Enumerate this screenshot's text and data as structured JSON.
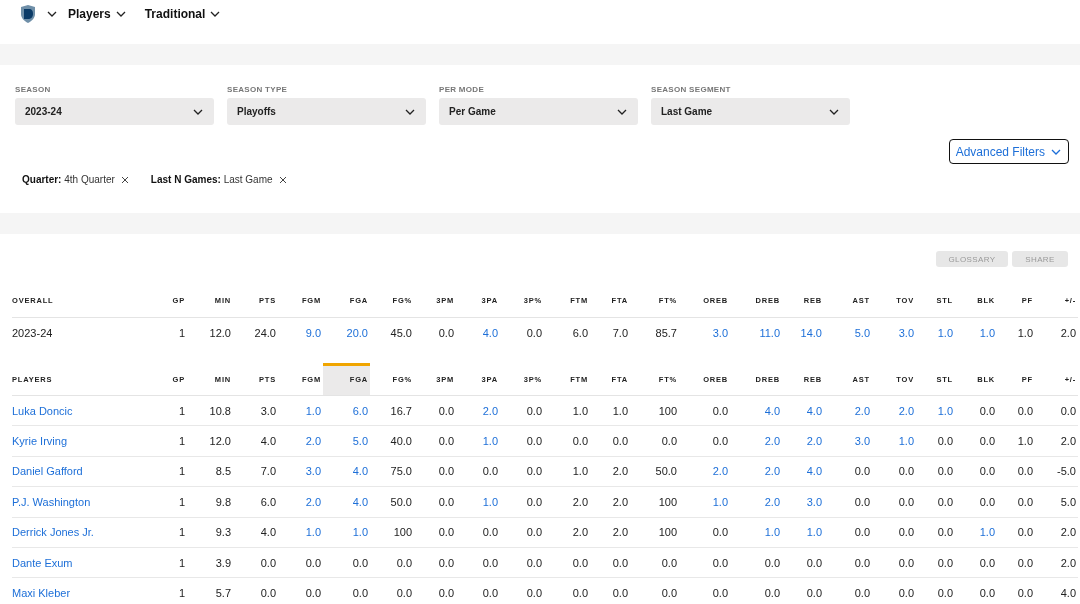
{
  "nav": {
    "items": [
      {
        "label": "Players"
      },
      {
        "label": "Traditional"
      }
    ]
  },
  "filters": [
    {
      "label": "SEASON",
      "value": "2023-24"
    },
    {
      "label": "SEASON TYPE",
      "value": "Playoffs"
    },
    {
      "label": "PER MODE",
      "value": "Per Game"
    },
    {
      "label": "SEASON SEGMENT",
      "value": "Last Game"
    }
  ],
  "advanced_filters": "Advanced Filters",
  "chips": [
    {
      "label": "Quarter:",
      "value": "4th Quarter"
    },
    {
      "label": "Last N Games:",
      "value": "Last Game"
    }
  ],
  "actions": [
    "GLOSSARY",
    "SHARE"
  ],
  "overall": {
    "columns": [
      {
        "label": "OVERALL",
        "sorted": false
      },
      {
        "label": "GP",
        "sorted": false
      },
      {
        "label": "MIN",
        "sorted": false
      },
      {
        "label": "PTS",
        "sorted": false
      },
      {
        "label": "FGM",
        "sorted": false
      },
      {
        "label": "FGA",
        "sorted": false
      },
      {
        "label": "FG%",
        "sorted": false
      },
      {
        "label": "3PM",
        "sorted": false
      },
      {
        "label": "3PA",
        "sorted": false
      },
      {
        "label": "3P%",
        "sorted": false
      },
      {
        "label": "FTM",
        "sorted": false
      },
      {
        "label": "FTA",
        "sorted": false
      },
      {
        "label": "FT%",
        "sorted": false
      },
      {
        "label": "OREB",
        "sorted": false
      },
      {
        "label": "DREB",
        "sorted": false
      },
      {
        "label": "REB",
        "sorted": false
      },
      {
        "label": "AST",
        "sorted": false
      },
      {
        "label": "TOV",
        "sorted": false
      },
      {
        "label": "STL",
        "sorted": false
      },
      {
        "label": "BLK",
        "sorted": false
      },
      {
        "label": "PF",
        "sorted": false
      },
      {
        "label": "+/-",
        "sorted": false
      }
    ],
    "rows": [
      {
        "cells": [
          {
            "text": "2023-24",
            "link": false
          },
          {
            "text": "1",
            "link": false
          },
          {
            "text": "12.0",
            "link": false
          },
          {
            "text": "24.0",
            "link": false
          },
          {
            "text": "9.0",
            "link": true
          },
          {
            "text": "20.0",
            "link": true
          },
          {
            "text": "45.0",
            "link": false
          },
          {
            "text": "0.0",
            "link": false
          },
          {
            "text": "4.0",
            "link": true
          },
          {
            "text": "0.0",
            "link": false
          },
          {
            "text": "6.0",
            "link": false
          },
          {
            "text": "7.0",
            "link": false
          },
          {
            "text": "85.7",
            "link": false
          },
          {
            "text": "3.0",
            "link": true
          },
          {
            "text": "11.0",
            "link": true
          },
          {
            "text": "14.0",
            "link": true
          },
          {
            "text": "5.0",
            "link": true
          },
          {
            "text": "3.0",
            "link": true
          },
          {
            "text": "1.0",
            "link": true
          },
          {
            "text": "1.0",
            "link": true
          },
          {
            "text": "1.0",
            "link": false
          },
          {
            "text": "2.0",
            "link": false
          }
        ]
      }
    ]
  },
  "players": {
    "columns": [
      {
        "label": "PLAYERS",
        "sorted": false
      },
      {
        "label": "GP",
        "sorted": false
      },
      {
        "label": "MIN",
        "sorted": false
      },
      {
        "label": "PTS",
        "sorted": false
      },
      {
        "label": "FGM",
        "sorted": false
      },
      {
        "label": "FGA",
        "sorted": true
      },
      {
        "label": "FG%",
        "sorted": false
      },
      {
        "label": "3PM",
        "sorted": false
      },
      {
        "label": "3PA",
        "sorted": false
      },
      {
        "label": "3P%",
        "sorted": false
      },
      {
        "label": "FTM",
        "sorted": false
      },
      {
        "label": "FTA",
        "sorted": false
      },
      {
        "label": "FT%",
        "sorted": false
      },
      {
        "label": "OREB",
        "sorted": false
      },
      {
        "label": "DREB",
        "sorted": false
      },
      {
        "label": "REB",
        "sorted": false
      },
      {
        "label": "AST",
        "sorted": false
      },
      {
        "label": "TOV",
        "sorted": false
      },
      {
        "label": "STL",
        "sorted": false
      },
      {
        "label": "BLK",
        "sorted": false
      },
      {
        "label": "PF",
        "sorted": false
      },
      {
        "label": "+/-",
        "sorted": false
      }
    ],
    "rows": [
      {
        "cells": [
          {
            "text": "Luka Doncic",
            "link": true
          },
          {
            "text": "1",
            "link": false
          },
          {
            "text": "10.8",
            "link": false
          },
          {
            "text": "3.0",
            "link": false
          },
          {
            "text": "1.0",
            "link": true
          },
          {
            "text": "6.0",
            "link": true
          },
          {
            "text": "16.7",
            "link": false
          },
          {
            "text": "0.0",
            "link": false
          },
          {
            "text": "2.0",
            "link": true
          },
          {
            "text": "0.0",
            "link": false
          },
          {
            "text": "1.0",
            "link": false
          },
          {
            "text": "1.0",
            "link": false
          },
          {
            "text": "100",
            "link": false
          },
          {
            "text": "0.0",
            "link": false
          },
          {
            "text": "4.0",
            "link": true
          },
          {
            "text": "4.0",
            "link": true
          },
          {
            "text": "2.0",
            "link": true
          },
          {
            "text": "2.0",
            "link": true
          },
          {
            "text": "1.0",
            "link": true
          },
          {
            "text": "0.0",
            "link": false
          },
          {
            "text": "0.0",
            "link": false
          },
          {
            "text": "0.0",
            "link": false
          }
        ]
      },
      {
        "cells": [
          {
            "text": "Kyrie Irving",
            "link": true
          },
          {
            "text": "1",
            "link": false
          },
          {
            "text": "12.0",
            "link": false
          },
          {
            "text": "4.0",
            "link": false
          },
          {
            "text": "2.0",
            "link": true
          },
          {
            "text": "5.0",
            "link": true
          },
          {
            "text": "40.0",
            "link": false
          },
          {
            "text": "0.0",
            "link": false
          },
          {
            "text": "1.0",
            "link": true
          },
          {
            "text": "0.0",
            "link": false
          },
          {
            "text": "0.0",
            "link": false
          },
          {
            "text": "0.0",
            "link": false
          },
          {
            "text": "0.0",
            "link": false
          },
          {
            "text": "0.0",
            "link": false
          },
          {
            "text": "2.0",
            "link": true
          },
          {
            "text": "2.0",
            "link": true
          },
          {
            "text": "3.0",
            "link": true
          },
          {
            "text": "1.0",
            "link": true
          },
          {
            "text": "0.0",
            "link": false
          },
          {
            "text": "0.0",
            "link": false
          },
          {
            "text": "1.0",
            "link": false
          },
          {
            "text": "2.0",
            "link": false
          }
        ]
      },
      {
        "cells": [
          {
            "text": "Daniel Gafford",
            "link": true
          },
          {
            "text": "1",
            "link": false
          },
          {
            "text": "8.5",
            "link": false
          },
          {
            "text": "7.0",
            "link": false
          },
          {
            "text": "3.0",
            "link": true
          },
          {
            "text": "4.0",
            "link": true
          },
          {
            "text": "75.0",
            "link": false
          },
          {
            "text": "0.0",
            "link": false
          },
          {
            "text": "0.0",
            "link": false
          },
          {
            "text": "0.0",
            "link": false
          },
          {
            "text": "1.0",
            "link": false
          },
          {
            "text": "2.0",
            "link": false
          },
          {
            "text": "50.0",
            "link": false
          },
          {
            "text": "2.0",
            "link": true
          },
          {
            "text": "2.0",
            "link": true
          },
          {
            "text": "4.0",
            "link": true
          },
          {
            "text": "0.0",
            "link": false
          },
          {
            "text": "0.0",
            "link": false
          },
          {
            "text": "0.0",
            "link": false
          },
          {
            "text": "0.0",
            "link": false
          },
          {
            "text": "0.0",
            "link": false
          },
          {
            "text": "-5.0",
            "link": false
          }
        ]
      },
      {
        "cells": [
          {
            "text": "P.J. Washington",
            "link": true
          },
          {
            "text": "1",
            "link": false
          },
          {
            "text": "9.8",
            "link": false
          },
          {
            "text": "6.0",
            "link": false
          },
          {
            "text": "2.0",
            "link": true
          },
          {
            "text": "4.0",
            "link": true
          },
          {
            "text": "50.0",
            "link": false
          },
          {
            "text": "0.0",
            "link": false
          },
          {
            "text": "1.0",
            "link": true
          },
          {
            "text": "0.0",
            "link": false
          },
          {
            "text": "2.0",
            "link": false
          },
          {
            "text": "2.0",
            "link": false
          },
          {
            "text": "100",
            "link": false
          },
          {
            "text": "1.0",
            "link": true
          },
          {
            "text": "2.0",
            "link": true
          },
          {
            "text": "3.0",
            "link": true
          },
          {
            "text": "0.0",
            "link": false
          },
          {
            "text": "0.0",
            "link": false
          },
          {
            "text": "0.0",
            "link": false
          },
          {
            "text": "0.0",
            "link": false
          },
          {
            "text": "0.0",
            "link": false
          },
          {
            "text": "5.0",
            "link": false
          }
        ]
      },
      {
        "cells": [
          {
            "text": "Derrick Jones Jr.",
            "link": true
          },
          {
            "text": "1",
            "link": false
          },
          {
            "text": "9.3",
            "link": false
          },
          {
            "text": "4.0",
            "link": false
          },
          {
            "text": "1.0",
            "link": true
          },
          {
            "text": "1.0",
            "link": true
          },
          {
            "text": "100",
            "link": false
          },
          {
            "text": "0.0",
            "link": false
          },
          {
            "text": "0.0",
            "link": false
          },
          {
            "text": "0.0",
            "link": false
          },
          {
            "text": "2.0",
            "link": false
          },
          {
            "text": "2.0",
            "link": false
          },
          {
            "text": "100",
            "link": false
          },
          {
            "text": "0.0",
            "link": false
          },
          {
            "text": "1.0",
            "link": true
          },
          {
            "text": "1.0",
            "link": true
          },
          {
            "text": "0.0",
            "link": false
          },
          {
            "text": "0.0",
            "link": false
          },
          {
            "text": "0.0",
            "link": false
          },
          {
            "text": "1.0",
            "link": true
          },
          {
            "text": "0.0",
            "link": false
          },
          {
            "text": "2.0",
            "link": false
          }
        ]
      },
      {
        "cells": [
          {
            "text": "Dante Exum",
            "link": true
          },
          {
            "text": "1",
            "link": false
          },
          {
            "text": "3.9",
            "link": false
          },
          {
            "text": "0.0",
            "link": false
          },
          {
            "text": "0.0",
            "link": false
          },
          {
            "text": "0.0",
            "link": false
          },
          {
            "text": "0.0",
            "link": false
          },
          {
            "text": "0.0",
            "link": false
          },
          {
            "text": "0.0",
            "link": false
          },
          {
            "text": "0.0",
            "link": false
          },
          {
            "text": "0.0",
            "link": false
          },
          {
            "text": "0.0",
            "link": false
          },
          {
            "text": "0.0",
            "link": false
          },
          {
            "text": "0.0",
            "link": false
          },
          {
            "text": "0.0",
            "link": false
          },
          {
            "text": "0.0",
            "link": false
          },
          {
            "text": "0.0",
            "link": false
          },
          {
            "text": "0.0",
            "link": false
          },
          {
            "text": "0.0",
            "link": false
          },
          {
            "text": "0.0",
            "link": false
          },
          {
            "text": "0.0",
            "link": false
          },
          {
            "text": "2.0",
            "link": false
          }
        ]
      },
      {
        "cells": [
          {
            "text": "Maxi Kleber",
            "link": true
          },
          {
            "text": "1",
            "link": false
          },
          {
            "text": "5.7",
            "link": false
          },
          {
            "text": "0.0",
            "link": false
          },
          {
            "text": "0.0",
            "link": false
          },
          {
            "text": "0.0",
            "link": false
          },
          {
            "text": "0.0",
            "link": false
          },
          {
            "text": "0.0",
            "link": false
          },
          {
            "text": "0.0",
            "link": false
          },
          {
            "text": "0.0",
            "link": false
          },
          {
            "text": "0.0",
            "link": false
          },
          {
            "text": "0.0",
            "link": false
          },
          {
            "text": "0.0",
            "link": false
          },
          {
            "text": "0.0",
            "link": false
          },
          {
            "text": "0.0",
            "link": false
          },
          {
            "text": "0.0",
            "link": false
          },
          {
            "text": "0.0",
            "link": false
          },
          {
            "text": "0.0",
            "link": false
          },
          {
            "text": "0.0",
            "link": false
          },
          {
            "text": "0.0",
            "link": false
          },
          {
            "text": "0.0",
            "link": false
          },
          {
            "text": "4.0",
            "link": false
          }
        ]
      }
    ]
  }
}
